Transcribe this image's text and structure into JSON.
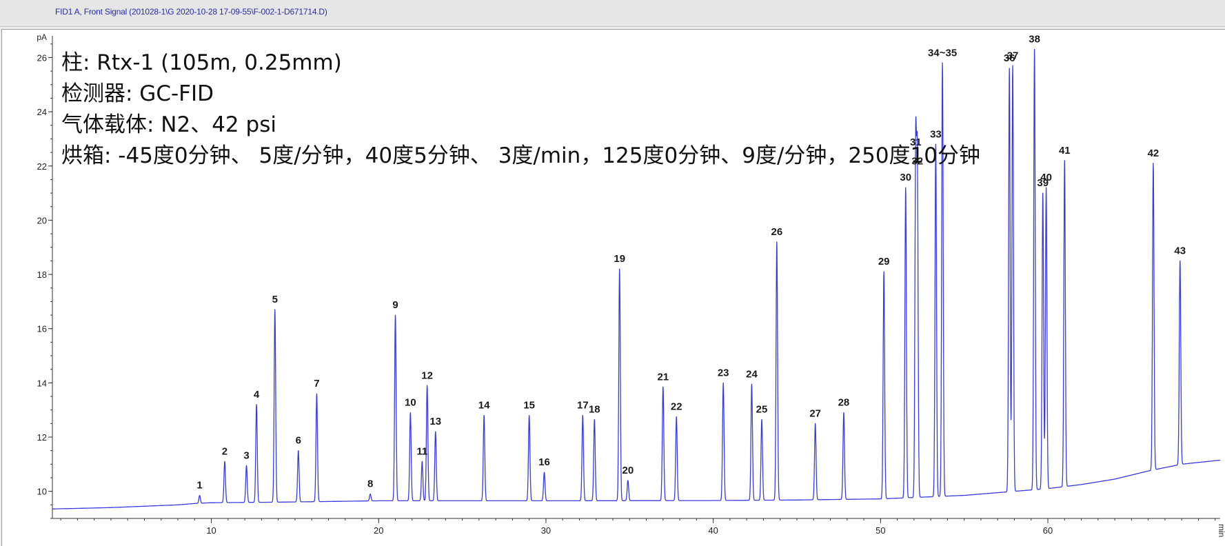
{
  "window": {
    "signal_title": "FID1 A, Front Signal (201028-1\\G 2020-10-28 17-09-55\\F-002-1-D671714.D)"
  },
  "annotation": {
    "lines": [
      "柱: Rtx-1 (105m, 0.25mm)",
      "检测器: GC-FID",
      "气体载体: N2、42 psi",
      "烘箱: -45度0分钟、 5度/分钟，40度5分钟、 3度/min，125度0分钟、9度/分钟，250度10分钟"
    ]
  },
  "colors": {
    "trace": "#3a3ae0",
    "axis": "#333333",
    "background": "#ffffff",
    "title": "#2a2aa8"
  },
  "chart_data": {
    "type": "line",
    "title": "",
    "xlabel": "min",
    "ylabel": "pA",
    "xlim": [
      0.5,
      70.3
    ],
    "ylim": [
      9.0,
      26.8
    ],
    "grid": false,
    "x_ticks": [
      10,
      20,
      30,
      40,
      50,
      60
    ],
    "x_minor_step": 1,
    "y_ticks": [
      10,
      12,
      14,
      16,
      18,
      20,
      22,
      24,
      26
    ],
    "y_minor_step": 0.5,
    "baseline": [
      [
        0.5,
        9.35
      ],
      [
        2.0,
        9.37
      ],
      [
        4.0,
        9.4
      ],
      [
        6.0,
        9.45
      ],
      [
        8.0,
        9.5
      ],
      [
        9.0,
        9.55
      ],
      [
        10.0,
        9.58
      ],
      [
        14.0,
        9.6
      ],
      [
        20.0,
        9.65
      ],
      [
        30.0,
        9.65
      ],
      [
        40.0,
        9.66
      ],
      [
        45.0,
        9.68
      ],
      [
        50.0,
        9.72
      ],
      [
        55.0,
        9.85
      ],
      [
        57.0,
        9.95
      ],
      [
        60.0,
        10.1
      ],
      [
        62.0,
        10.25
      ],
      [
        64.0,
        10.45
      ],
      [
        66.0,
        10.75
      ],
      [
        68.0,
        11.0
      ],
      [
        70.3,
        11.15
      ]
    ],
    "peaks": [
      {
        "label": "1",
        "rt": 9.3,
        "height": 9.85
      },
      {
        "label": "2",
        "rt": 10.8,
        "height": 11.1
      },
      {
        "label": "3",
        "rt": 12.1,
        "height": 10.95
      },
      {
        "label": "4",
        "rt": 12.7,
        "height": 13.2
      },
      {
        "label": "5",
        "rt": 13.8,
        "height": 16.7
      },
      {
        "label": "6",
        "rt": 15.2,
        "height": 11.5
      },
      {
        "label": "7",
        "rt": 16.3,
        "height": 13.6
      },
      {
        "label": "8",
        "rt": 19.5,
        "height": 9.9
      },
      {
        "label": "9",
        "rt": 21.0,
        "height": 16.5
      },
      {
        "label": "10",
        "rt": 21.9,
        "height": 12.9
      },
      {
        "label": "11",
        "rt": 22.6,
        "height": 11.1
      },
      {
        "label": "12",
        "rt": 22.9,
        "height": 13.9
      },
      {
        "label": "13",
        "rt": 23.4,
        "height": 12.2
      },
      {
        "label": "14",
        "rt": 26.3,
        "height": 12.8
      },
      {
        "label": "15",
        "rt": 29.0,
        "height": 12.8
      },
      {
        "label": "16",
        "rt": 29.9,
        "height": 10.7
      },
      {
        "label": "17",
        "rt": 32.2,
        "height": 12.8
      },
      {
        "label": "18",
        "rt": 32.9,
        "height": 12.65
      },
      {
        "label": "19",
        "rt": 34.4,
        "height": 18.2
      },
      {
        "label": "20",
        "rt": 34.9,
        "height": 10.4
      },
      {
        "label": "21",
        "rt": 37.0,
        "height": 13.85
      },
      {
        "label": "22",
        "rt": 37.8,
        "height": 12.75
      },
      {
        "label": "23",
        "rt": 40.6,
        "height": 14.0
      },
      {
        "label": "24",
        "rt": 42.3,
        "height": 13.95
      },
      {
        "label": "25",
        "rt": 42.9,
        "height": 12.65
      },
      {
        "label": "26",
        "rt": 43.8,
        "height": 19.2
      },
      {
        "label": "27",
        "rt": 46.1,
        "height": 12.5
      },
      {
        "label": "28",
        "rt": 47.8,
        "height": 12.9
      },
      {
        "label": "29",
        "rt": 50.2,
        "height": 18.1
      },
      {
        "label": "30",
        "rt": 51.5,
        "height": 21.2
      },
      {
        "label": "31",
        "rt": 52.1,
        "height": 22.5
      },
      {
        "label": "32",
        "rt": 52.2,
        "height": 21.8
      },
      {
        "label": "33",
        "rt": 53.3,
        "height": 22.8
      },
      {
        "label": "34~35",
        "rt": 53.7,
        "height": 25.8
      },
      {
        "label": "36",
        "rt": 57.7,
        "height": 25.6
      },
      {
        "label": "37",
        "rt": 57.9,
        "height": 25.7
      },
      {
        "label": "38",
        "rt": 59.2,
        "height": 26.3
      },
      {
        "label": "39",
        "rt": 59.7,
        "height": 21.0
      },
      {
        "label": "40",
        "rt": 59.9,
        "height": 21.2
      },
      {
        "label": "41",
        "rt": 61.0,
        "height": 22.2
      },
      {
        "label": "42",
        "rt": 66.3,
        "height": 22.1
      },
      {
        "label": "43",
        "rt": 67.9,
        "height": 18.5
      }
    ]
  }
}
